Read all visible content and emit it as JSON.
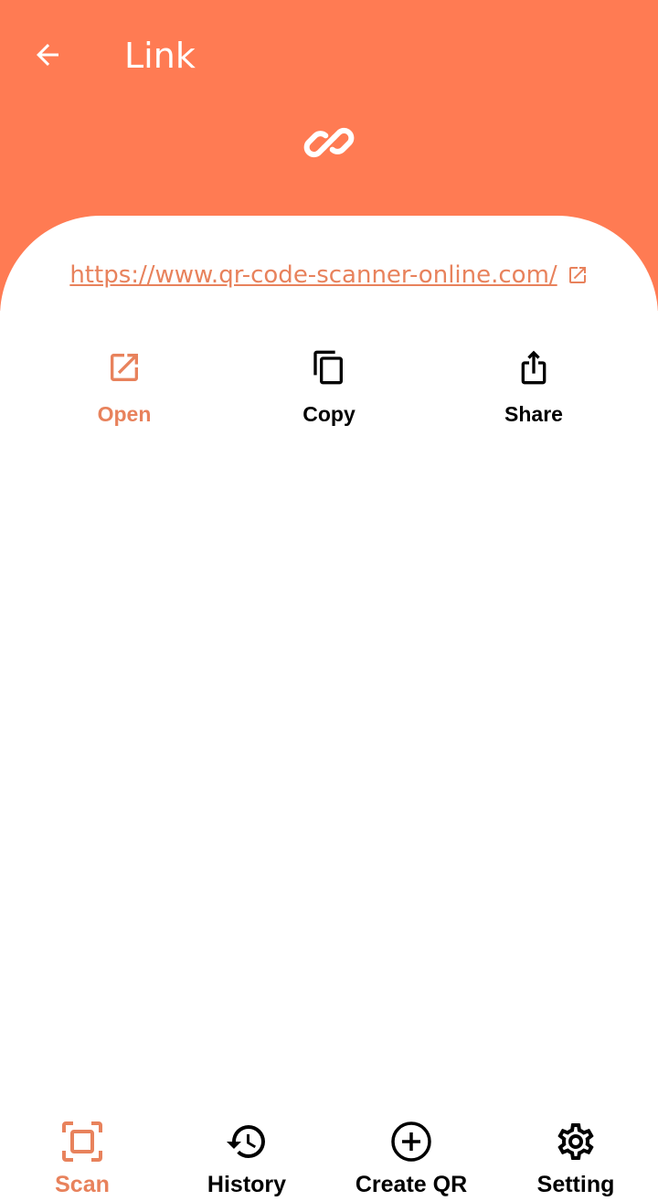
{
  "header": {
    "title": "Link",
    "back_icon": "arrow-left-icon",
    "type_icon": "link-icon",
    "background_color": "#FF7B53"
  },
  "content": {
    "url": "https://www.qr-code-scanner-online.com/",
    "url_icon": "open-external-icon",
    "accent_color": "#E8825C"
  },
  "actions": [
    {
      "label": "Open",
      "icon": "open-external-icon",
      "active": true
    },
    {
      "label": "Copy",
      "icon": "copy-icon",
      "active": false
    },
    {
      "label": "Share",
      "icon": "share-icon",
      "active": false
    }
  ],
  "nav": [
    {
      "label": "Scan",
      "icon": "scan-icon",
      "active": true
    },
    {
      "label": "History",
      "icon": "history-icon",
      "active": false
    },
    {
      "label": "Create QR",
      "icon": "add-circle-icon",
      "active": false
    },
    {
      "label": "Setting",
      "icon": "gear-icon",
      "active": false
    }
  ]
}
